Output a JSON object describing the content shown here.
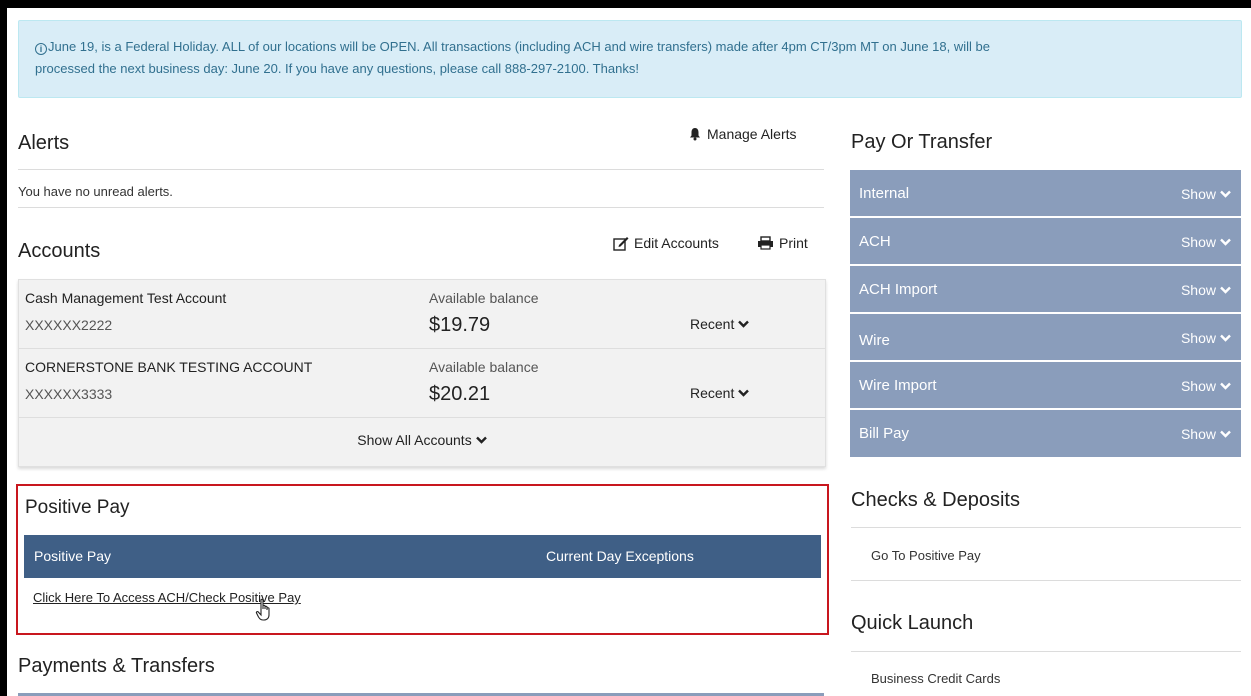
{
  "banner": {
    "icon": "info-circle-icon",
    "line1": "June 19, is a Federal Holiday. ALL of our locations will be OPEN. All transactions (including ACH and wire transfers) made after 4pm CT/3pm MT on June 18, will be",
    "line2": "processed the next business day: June 20. If you have any questions, please call 888-297-2100. Thanks!"
  },
  "alerts": {
    "title": "Alerts",
    "manage_label": "Manage Alerts",
    "empty_text": "You have no unread alerts."
  },
  "accounts": {
    "title": "Accounts",
    "edit_label": "Edit Accounts",
    "print_label": "Print",
    "items": [
      {
        "name": "Cash Management Test Account",
        "number": "XXXXXX2222",
        "balance_label": "Available balance",
        "balance": "$19.79",
        "recent_label": "Recent"
      },
      {
        "name": "CORNERSTONE BANK TESTING ACCOUNT",
        "number": "XXXXXX3333",
        "balance_label": "Available balance",
        "balance": "$20.21",
        "recent_label": "Recent"
      }
    ],
    "show_all_label": "Show All Accounts"
  },
  "positive_pay": {
    "title": "Positive Pay",
    "col1": "Positive Pay",
    "col2": "Current Day Exceptions",
    "link": "Click Here To Access ACH/Check Positive Pay",
    "highlight_color": "#c8171e",
    "bar_color": "#3f5f86"
  },
  "payments": {
    "title": "Payments & Transfers"
  },
  "pay_or_transfer": {
    "title": "Pay Or Transfer",
    "row_color": "#8a9dbb",
    "rows": [
      {
        "label": "Internal",
        "show": "Show"
      },
      {
        "label": "ACH",
        "show": "Show"
      },
      {
        "label": "ACH Import",
        "show": "Show"
      },
      {
        "label": "Wire",
        "show": "Show"
      },
      {
        "label": "Wire Import",
        "show": "Show"
      },
      {
        "label": "Bill Pay",
        "show": "Show"
      }
    ]
  },
  "checks_deposits": {
    "title": "Checks & Deposits",
    "link": "Go To Positive Pay"
  },
  "quick_launch": {
    "title": "Quick Launch",
    "link": "Business Credit Cards"
  }
}
